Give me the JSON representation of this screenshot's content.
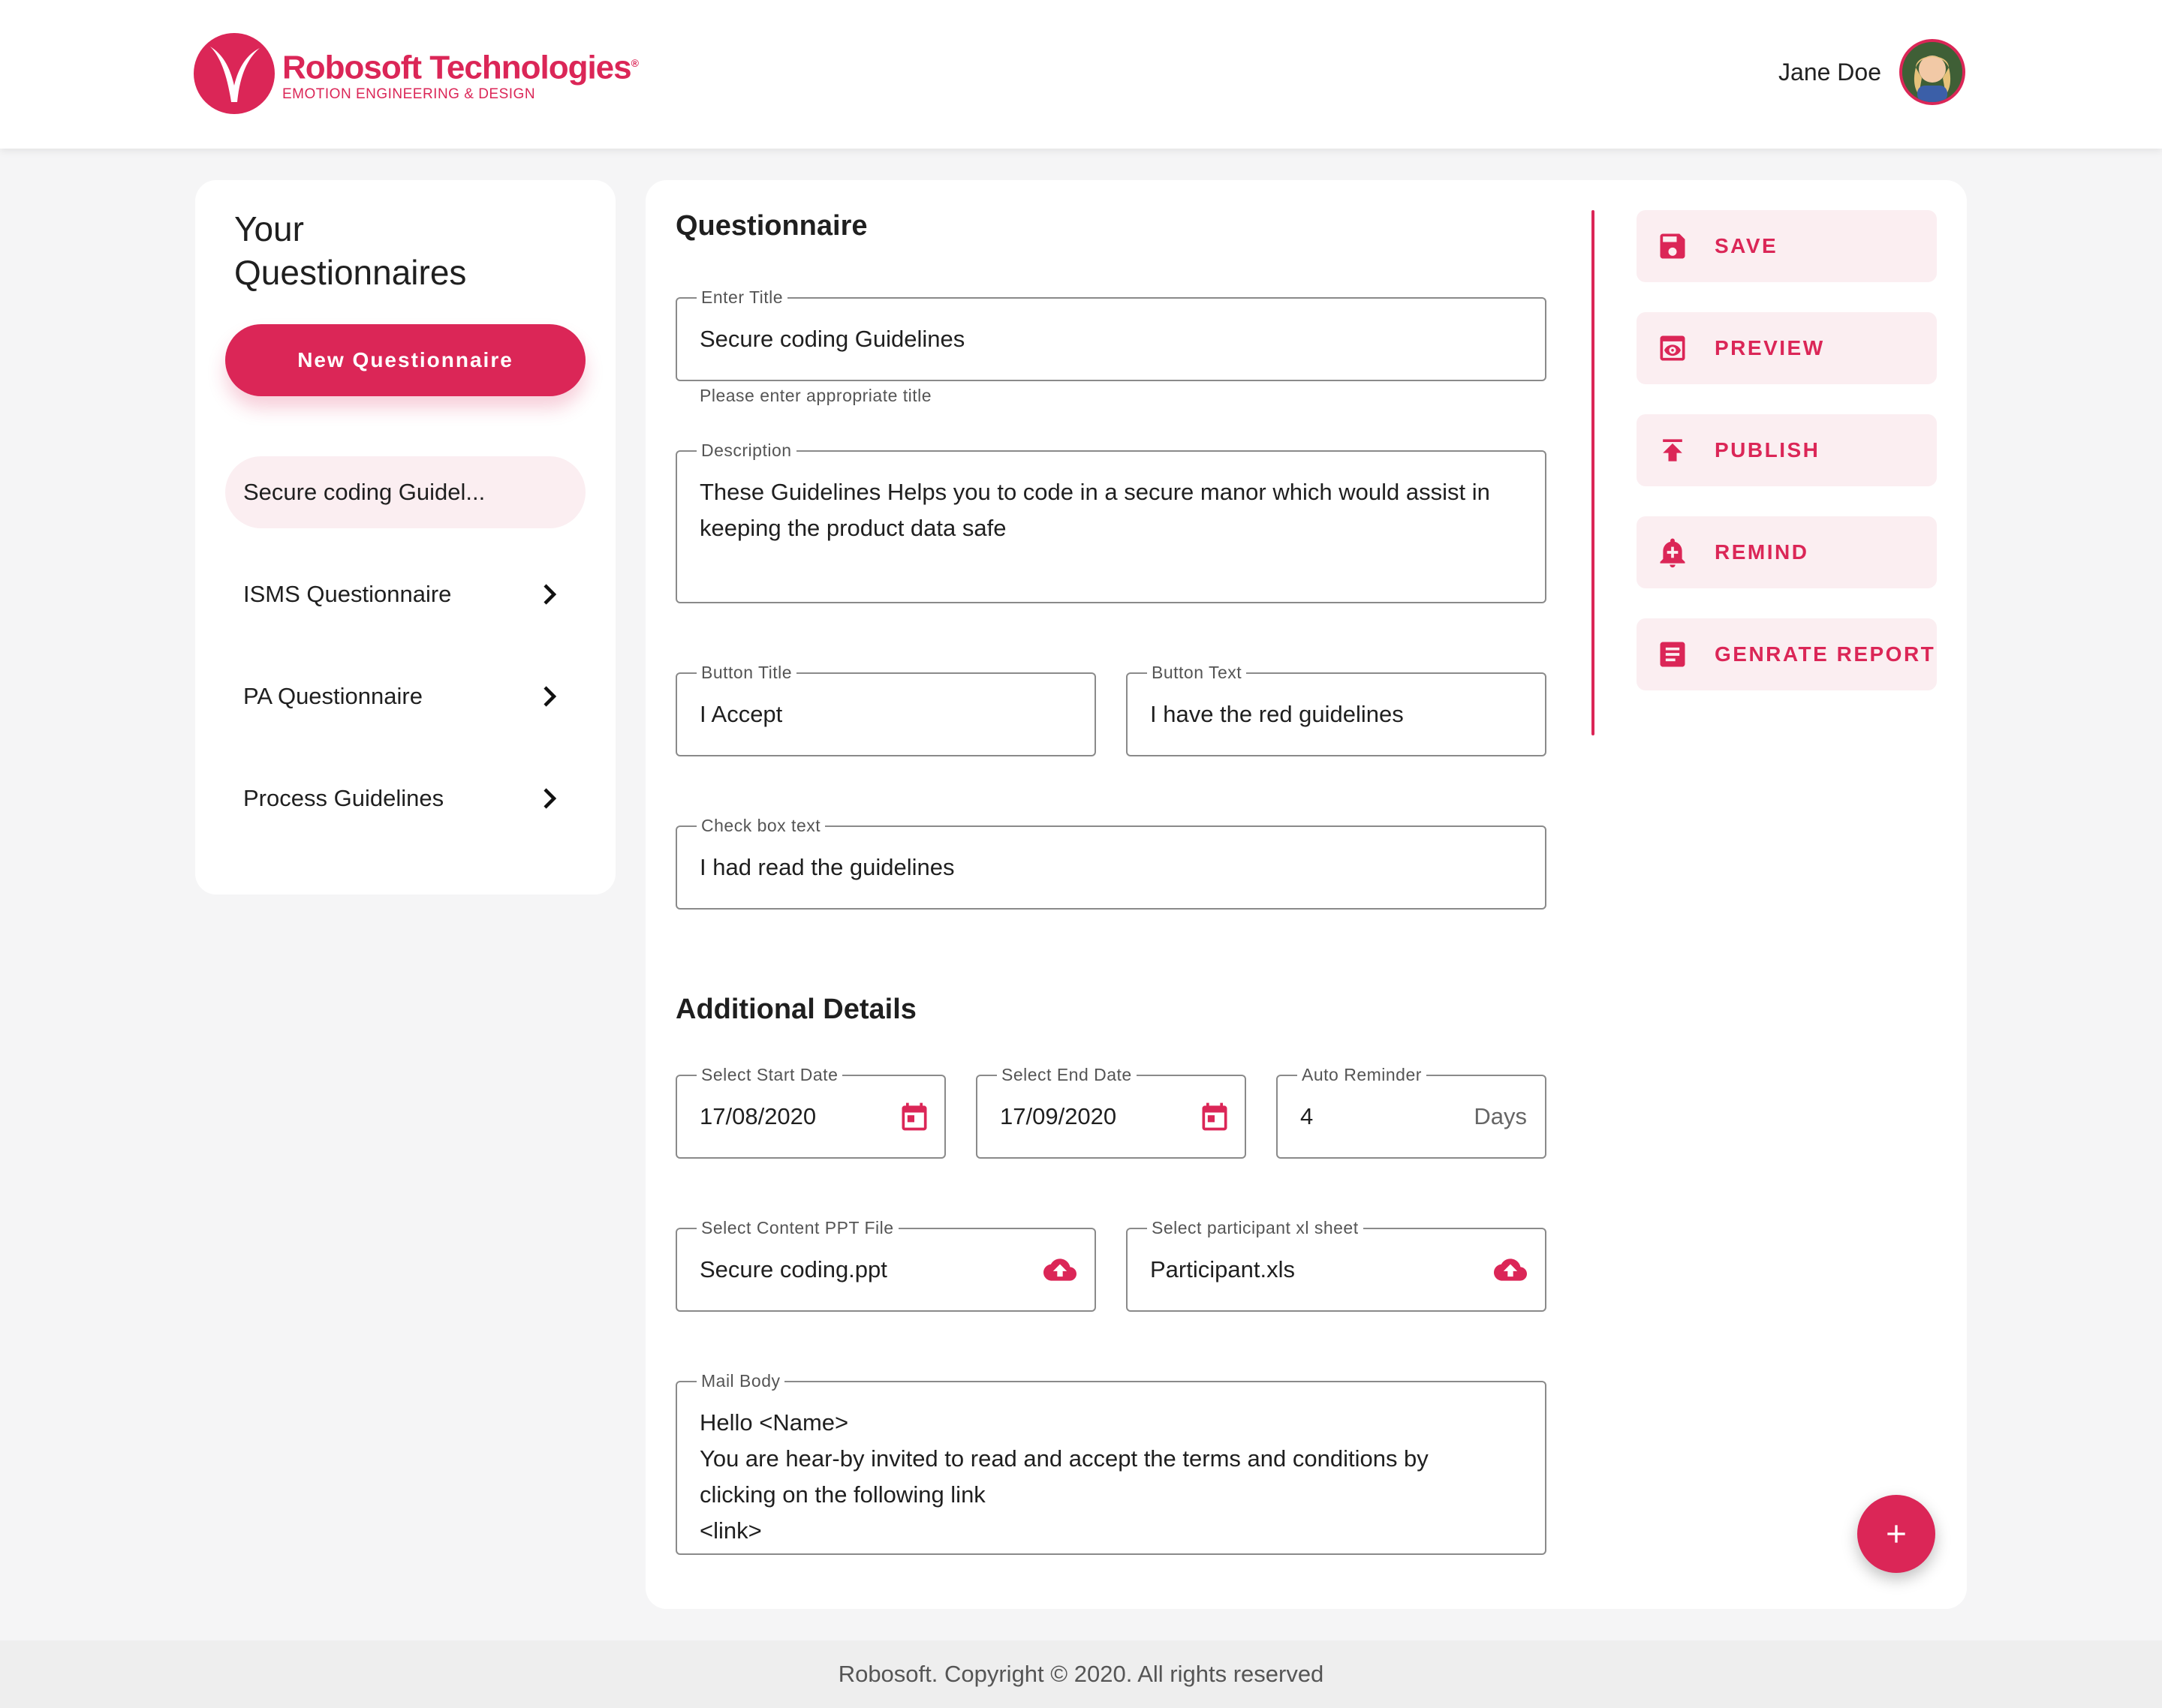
{
  "header": {
    "brand_name": "Robosoft Technologies",
    "brand_mark": "®",
    "brand_tagline": "EMOTION ENGINEERING & DESIGN",
    "user_name": "Jane Doe"
  },
  "sidebar": {
    "title": "Your Questionnaires",
    "new_button": "New Questionnaire",
    "items": [
      {
        "label": "Secure coding Guidel...",
        "active": true
      },
      {
        "label": "ISMS Questionnaire"
      },
      {
        "label": "PA Questionnaire"
      },
      {
        "label": "Process Guidelines"
      }
    ]
  },
  "form": {
    "title": "Questionnaire",
    "title_field": {
      "label": "Enter Title",
      "value": "Secure coding Guidelines",
      "helper": "Please enter appropriate title"
    },
    "description": {
      "label": "Description",
      "line1": "These Guidelines Helps you to code in a secure manor which would assist in",
      "line2": "keeping the product data safe"
    },
    "button_title": {
      "label": "Button Title",
      "value": "I Accept"
    },
    "button_text": {
      "label": "Button Text",
      "value": "I have the red guidelines"
    },
    "checkbox_text": {
      "label": "Check box text",
      "value": "I had read the guidelines"
    }
  },
  "additional": {
    "title": "Additional Details",
    "start_date": {
      "label": "Select Start Date",
      "value": "17/08/2020"
    },
    "end_date": {
      "label": "Select End Date",
      "value": "17/09/2020"
    },
    "auto_reminder": {
      "label": "Auto Reminder",
      "value": "4",
      "suffix": "Days"
    },
    "ppt_file": {
      "label": "Select Content PPT File",
      "value": "Secure coding.ppt"
    },
    "participant_file": {
      "label": "Select participant xl sheet",
      "value": "Participant.xls"
    },
    "mail_body": {
      "label": "Mail Body",
      "line1": "Hello <Name>",
      "line2": "You are hear-by invited to read and accept the terms and conditions by",
      "line3": "clicking on the following link",
      "line4": "<link>"
    }
  },
  "actions": [
    {
      "label": "SAVE",
      "icon": "save-icon"
    },
    {
      "label": "PREVIEW",
      "icon": "preview-icon"
    },
    {
      "label": "PUBLISH",
      "icon": "publish-icon"
    },
    {
      "label": "REMIND",
      "icon": "bell-icon"
    },
    {
      "label": "GENRATE REPORT",
      "icon": "report-icon"
    }
  ],
  "footer": {
    "text": "Robosoft. Copyright © 2020. All rights reserved"
  },
  "colors": {
    "accent": "#db2657",
    "accent_light": "#fbeef1",
    "background": "#f5f5f6"
  }
}
